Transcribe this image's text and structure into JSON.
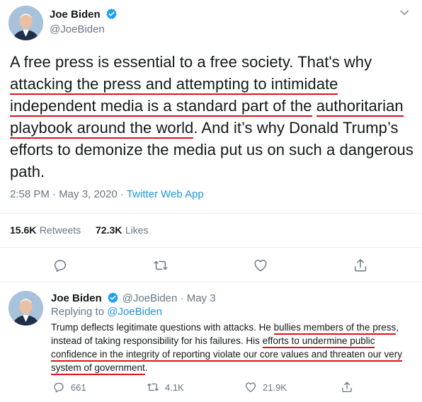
{
  "tweet": {
    "author_name": "Joe Biden",
    "author_handle": "@JoeBiden",
    "text_parts": [
      "A free press is essential to a free society. That's why ",
      "attacking the press and attempting to intimidate",
      " ",
      "independent media is a standard part of the",
      " ",
      "authoritarian playbook around the world",
      ". And it’s why Donald Trump’s efforts to demonize the media put us on such a dangerous path."
    ],
    "timestamp": "2:58 PM · May 3, 2020 · ",
    "source": "Twitter Web App",
    "retweets_count": "15.6K",
    "retweets_label": "Retweets",
    "likes_count": "72.3K",
    "likes_label": "Likes"
  },
  "reply": {
    "author_name": "Joe Biden",
    "author_handle": "@JoeBiden",
    "date": " · May 3",
    "replying_label": "Replying to ",
    "replying_handle": "@JoeBiden",
    "text_parts": [
      "Trump deflects legitimate questions with attacks. He ",
      "bullies members of the press",
      ", instead of taking responsibility for his failures. His ",
      "efforts to undermine public confidence in the integrity of reporting violate our core values and threaten our very system of government",
      "."
    ],
    "reply_count": "661",
    "retweet_count": "4.1K",
    "like_count": "21.9K"
  },
  "icons": [
    "verified-badge-icon",
    "chevron-down-icon",
    "reply-icon",
    "retweet-icon",
    "like-icon",
    "share-icon"
  ],
  "colors": {
    "accent": "#1da1f2",
    "link": "#1b95e0",
    "underline": "#e0101a",
    "muted": "#657786"
  }
}
